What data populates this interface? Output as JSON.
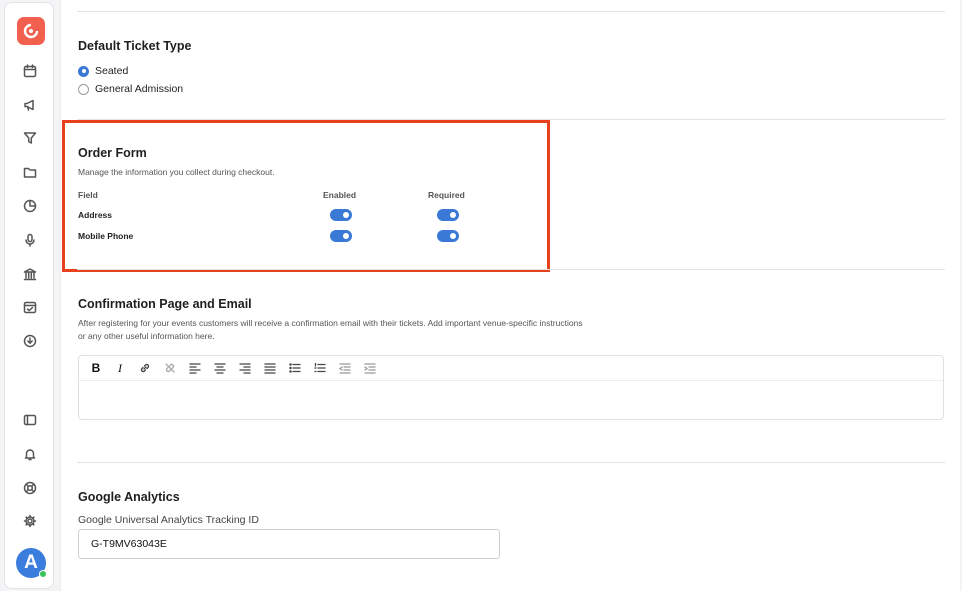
{
  "colors": {
    "accent": "#3a79d6",
    "brand": "#f1604f",
    "highlight": "#e8401c",
    "online": "#37c25a"
  },
  "sidebar": {
    "logo": "brand-logo-icon",
    "items": [
      {
        "icon": "calendar-icon"
      },
      {
        "icon": "megaphone-icon"
      },
      {
        "icon": "filter-icon"
      },
      {
        "icon": "folder-icon"
      },
      {
        "icon": "pie-chart-icon"
      },
      {
        "icon": "microphone-icon"
      },
      {
        "icon": "bank-icon"
      },
      {
        "icon": "calendar-check-icon"
      },
      {
        "icon": "download-icon"
      }
    ],
    "bottom_items": [
      {
        "icon": "panel-icon"
      },
      {
        "icon": "bell-icon"
      },
      {
        "icon": "lifebuoy-icon"
      },
      {
        "icon": "gear-icon"
      }
    ],
    "avatar_initial": "A"
  },
  "ticket_type": {
    "title": "Default Ticket Type",
    "options": [
      {
        "label": "Seated",
        "checked": true
      },
      {
        "label": "General Admission",
        "checked": false
      }
    ]
  },
  "order_form": {
    "title": "Order Form",
    "description": "Manage the information you collect during checkout.",
    "columns": {
      "field": "Field",
      "enabled": "Enabled",
      "required": "Required"
    },
    "rows": [
      {
        "label": "Address",
        "enabled": true,
        "required": true
      },
      {
        "label": "Mobile Phone",
        "enabled": true,
        "required": true
      }
    ]
  },
  "confirmation": {
    "title": "Confirmation Page and Email",
    "description_line1": "After registering for your events customers will receive a confirmation email with their tickets. Add important venue-specific instructions",
    "description_line2": "or any other useful information here.",
    "toolbar": {
      "bold": "B",
      "italic": "I"
    },
    "content": ""
  },
  "analytics": {
    "title": "Google Analytics",
    "field_label": "Google Universal Analytics Tracking ID",
    "value": "G-T9MV63043E"
  }
}
